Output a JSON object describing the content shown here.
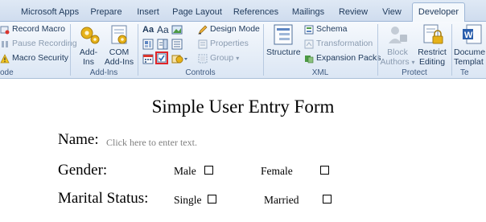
{
  "tabs": [
    "Microsoft Apps",
    "Prepare",
    "Insert",
    "Page Layout",
    "References",
    "Mailings",
    "Review",
    "View",
    "Developer"
  ],
  "active_tab": "Developer",
  "ribbon": {
    "code": {
      "record_macro": "Record Macro",
      "pause_recording": "Pause Recording",
      "macro_security": "Macro Security",
      "label_partial": "ode"
    },
    "addins": {
      "addins_button": "Add-Ins",
      "com_addins_line1": "COM",
      "com_addins_line2": "Add-Ins",
      "label": "Add-Ins"
    },
    "controls": {
      "rich_text": "Aa",
      "plain_text": "Aa",
      "design_mode": "Design Mode",
      "properties": "Properties",
      "group": "Group",
      "label": "Controls"
    },
    "xml": {
      "structure": "Structure",
      "schema": "Schema",
      "transformation": "Transformation",
      "expansion_packs": "Expansion Packs",
      "label": "XML"
    },
    "protect": {
      "block_authors_line1": "Block",
      "block_authors_line2": "Authors",
      "restrict_editing_line1": "Restrict",
      "restrict_editing_line2": "Editing",
      "label": "Protect"
    },
    "templates": {
      "document_template_line1": "Docume",
      "document_template_line2": "Templat",
      "label_partial": "Te"
    }
  },
  "document": {
    "title": "Simple User Entry Form",
    "name_label": "Name:",
    "name_placeholder": "Click here to enter text.",
    "gender_label": "Gender:",
    "gender_options": [
      "Male",
      "Female"
    ],
    "marital_label": "Marital Status:",
    "marital_options": [
      "Single",
      "Married"
    ]
  },
  "colors": {
    "highlight_box": "#e0262a",
    "ribbon_text": "#1e395b",
    "disabled_text": "#8a9bb0"
  }
}
